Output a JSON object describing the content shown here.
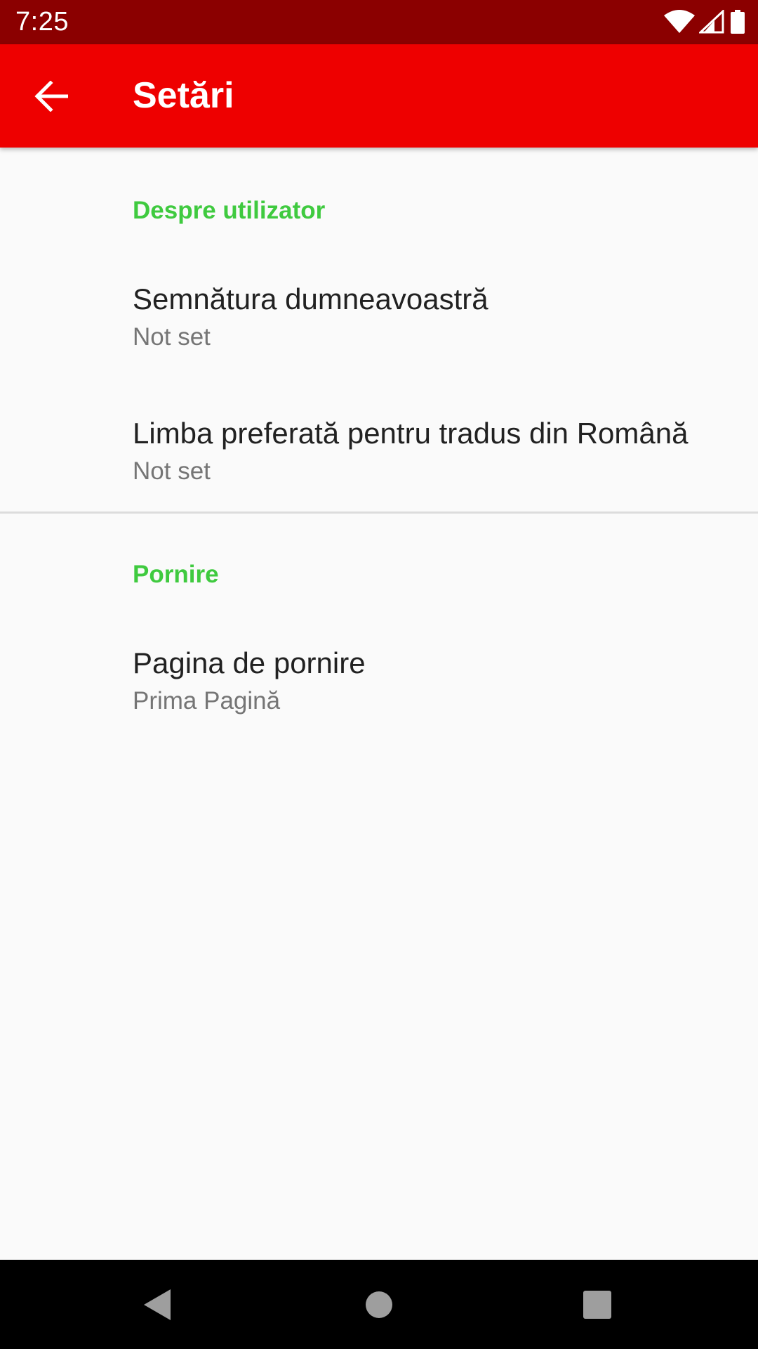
{
  "status_bar": {
    "time": "7:25",
    "icons": [
      "wifi-icon",
      "signal-icon",
      "battery-icon"
    ]
  },
  "app_bar": {
    "back_icon": "arrow-back-icon",
    "title": "Setări",
    "background_color": "#ee0000"
  },
  "settings": {
    "categories": [
      {
        "title": "Despre utilizator",
        "items": [
          {
            "title": "Semnătura dumneavoastră",
            "summary": "Not set"
          },
          {
            "title": "Limba preferată pentru tradus din Română",
            "summary": "Not set"
          }
        ]
      },
      {
        "title": "Pornire",
        "items": [
          {
            "title": "Pagina de pornire",
            "summary": "Prima Pagină"
          }
        ]
      }
    ],
    "category_color": "#3fca3f"
  },
  "nav_bar": {
    "buttons": [
      "back-triangle-icon",
      "home-circle-icon",
      "recents-square-icon"
    ]
  }
}
